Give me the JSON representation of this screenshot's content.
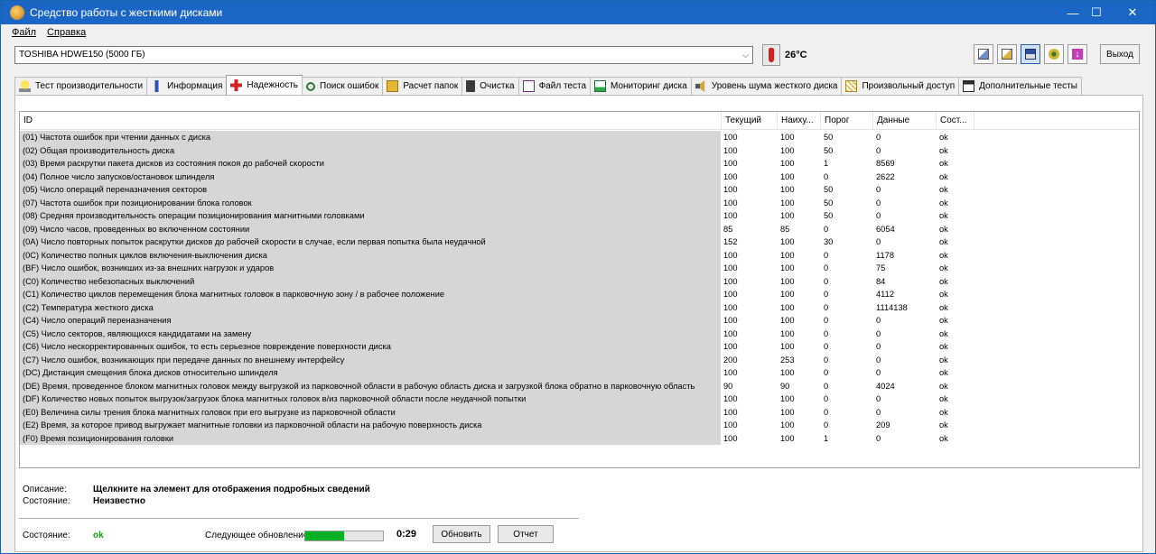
{
  "window": {
    "title": "Средство работы с жесткими дисками",
    "minimize": "—",
    "maximize": "☐",
    "close": "✕"
  },
  "menu": [
    "Файл",
    "Справка"
  ],
  "toolbar": {
    "drive": "TOSHIBA HDWE150 (5000 ГБ)",
    "temperature": "26°C",
    "exit_label": "Выход"
  },
  "tabs": [
    {
      "label": "Тест производительности",
      "icon": "bulb-icon"
    },
    {
      "label": "Информация",
      "icon": "info-icon"
    },
    {
      "label": "Надежность",
      "icon": "health-cross-icon"
    },
    {
      "label": "Поиск ошибок",
      "icon": "magnifier-icon"
    },
    {
      "label": "Расчет папок",
      "icon": "folder-icon"
    },
    {
      "label": "Очистка",
      "icon": "trash-icon"
    },
    {
      "label": "Файл теста",
      "icon": "file-test-icon"
    },
    {
      "label": "Мониторинг диска",
      "icon": "monitor-chart-icon"
    },
    {
      "label": "Уровень шума жесткого диска",
      "icon": "speaker-icon"
    },
    {
      "label": "Произвольный доступ",
      "icon": "random-access-icon"
    },
    {
      "label": "Дополнительные тесты",
      "icon": "extra-tests-icon"
    }
  ],
  "grid": {
    "columns": [
      "ID",
      "Текущий",
      "Наиху...",
      "Порог",
      "Данные",
      "Сост..."
    ],
    "rows": [
      [
        "(01) Частота ошибок при чтении данных с диска",
        "100",
        "100",
        "50",
        "0",
        "ok"
      ],
      [
        "(02) Общая производительность диска",
        "100",
        "100",
        "50",
        "0",
        "ok"
      ],
      [
        "(03) Время раскрутки пакета дисков из состояния покоя до рабочей скорости",
        "100",
        "100",
        "1",
        "8569",
        "ok"
      ],
      [
        "(04) Полное число запусков/остановок шпинделя",
        "100",
        "100",
        "0",
        "2622",
        "ok"
      ],
      [
        "(05) Число операций переназначения секторов",
        "100",
        "100",
        "50",
        "0",
        "ok"
      ],
      [
        "(07) Частота ошибок при позиционировании блока головок",
        "100",
        "100",
        "50",
        "0",
        "ok"
      ],
      [
        "(08) Средняя производительность операции позиционирования магнитными головками",
        "100",
        "100",
        "50",
        "0",
        "ok"
      ],
      [
        "(09) Число часов, проведенных во включенном состоянии",
        "85",
        "85",
        "0",
        "6054",
        "ok"
      ],
      [
        "(0A) Число повторных попыток раскрутки дисков до рабочей скорости в случае, если первая попытка была неудачной",
        "152",
        "100",
        "30",
        "0",
        "ok"
      ],
      [
        "(0C) Количество полных циклов включения-выключения диска",
        "100",
        "100",
        "0",
        "1178",
        "ok"
      ],
      [
        "(BF) Число ошибок, возникших из-за внешних нагрузок и ударов",
        "100",
        "100",
        "0",
        "75",
        "ok"
      ],
      [
        "(C0) Количество небезопасных выключений",
        "100",
        "100",
        "0",
        "84",
        "ok"
      ],
      [
        "(C1) Количество циклов перемещения блока магнитных головок в парковочную зону / в рабочее положение",
        "100",
        "100",
        "0",
        "4112",
        "ok"
      ],
      [
        "(C2) Температура жесткого диска",
        "100",
        "100",
        "0",
        "1114138",
        "ok"
      ],
      [
        "(C4) Число операций переназначения",
        "100",
        "100",
        "0",
        "0",
        "ok"
      ],
      [
        "(C5) Число секторов, являющихся кандидатами на замену",
        "100",
        "100",
        "0",
        "0",
        "ok"
      ],
      [
        "(C6) Число нескорректированных ошибок, то есть серьезное повреждение поверхности диска",
        "100",
        "100",
        "0",
        "0",
        "ok"
      ],
      [
        "(C7) Число ошибок, возникающих при передаче данных по внешнему интерфейсу",
        "200",
        "253",
        "0",
        "0",
        "ok"
      ],
      [
        "(DC) Дистанция смещения блока дисков относительно шпинделя",
        "100",
        "100",
        "0",
        "0",
        "ok"
      ],
      [
        "(DE) Время, проведенное блоком магнитных головок между выгрузкой из парковочной области в рабочую область диска и загрузкой блока обратно в парковочную область",
        "90",
        "90",
        "0",
        "4024",
        "ok"
      ],
      [
        "(DF) Количество новых попыток выгрузок/загрузок блока магнитных головок в/из парковочной области после неудачной попытки",
        "100",
        "100",
        "0",
        "0",
        "ok"
      ],
      [
        "(E0) Величина силы трения блока магнитных головок при его выгрузке из парковочной области",
        "100",
        "100",
        "0",
        "0",
        "ok"
      ],
      [
        "(E2) Время, за которое привод выгружает магнитные головки из парковочной области на рабочую поверхность диска",
        "100",
        "100",
        "0",
        "209",
        "ok"
      ],
      [
        "(F0) Время позиционирования головки",
        "100",
        "100",
        "1",
        "0",
        "ok"
      ]
    ]
  },
  "details": {
    "description_label": "Описание:",
    "description_value": "Щелкните на элемент для отображения подробных сведений",
    "state_label": "Состояние:",
    "state_value": "Неизвестно"
  },
  "status": {
    "state_label": "Состояние:",
    "state_value": "ok",
    "next_update_label": "Следующее обновление:",
    "progress_fraction": 0.5,
    "countdown": "0:29",
    "refresh_label": "Обновить",
    "report_label": "Отчет"
  },
  "colors": {
    "titlebar": "#1b66c5",
    "ok_status": "#1a9a1a",
    "progress": "#06b025",
    "id_column_bg": "#d6d6d6"
  }
}
